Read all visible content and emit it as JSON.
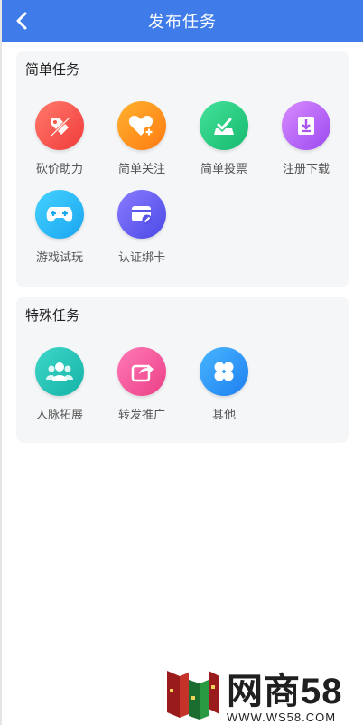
{
  "header": {
    "title": "发布任务",
    "back_icon": "chevron-left-icon"
  },
  "colors": {
    "header_bg": "#3f7ce9",
    "card_bg": "#f5f6f8"
  },
  "simple_tasks": {
    "title": "简单任务",
    "items": [
      {
        "label": "砍价助力",
        "icon": "price-tag-slash-icon",
        "gradient": [
          "#ff7a6b",
          "#f13b3b"
        ]
      },
      {
        "label": "简单关注",
        "icon": "heart-plus-icon",
        "gradient": [
          "#ffb22e",
          "#ff7a13"
        ]
      },
      {
        "label": "简单投票",
        "icon": "vote-box-icon",
        "gradient": [
          "#45e19a",
          "#14b96e"
        ]
      },
      {
        "label": "注册下载",
        "icon": "download-icon",
        "gradient": [
          "#d88bff",
          "#9b49f0"
        ]
      },
      {
        "label": "游戏试玩",
        "icon": "gamepad-icon",
        "gradient": [
          "#45d2ff",
          "#1aa5f0"
        ]
      },
      {
        "label": "认证绑卡",
        "icon": "card-link-icon",
        "gradient": [
          "#8a7bff",
          "#4a49e6"
        ]
      }
    ]
  },
  "special_tasks": {
    "title": "特殊任务",
    "items": [
      {
        "label": "人脉拓展",
        "icon": "people-icon",
        "gradient": [
          "#3fd7c9",
          "#14b3a6"
        ]
      },
      {
        "label": "转发推广",
        "icon": "share-icon",
        "gradient": [
          "#ff7ab6",
          "#ec3f86"
        ]
      },
      {
        "label": "其他",
        "icon": "clover-icon",
        "gradient": [
          "#48b6ff",
          "#1e7ff0"
        ]
      }
    ]
  },
  "watermark": {
    "main": "网商58",
    "sub": "WWW.WS58.COM"
  }
}
